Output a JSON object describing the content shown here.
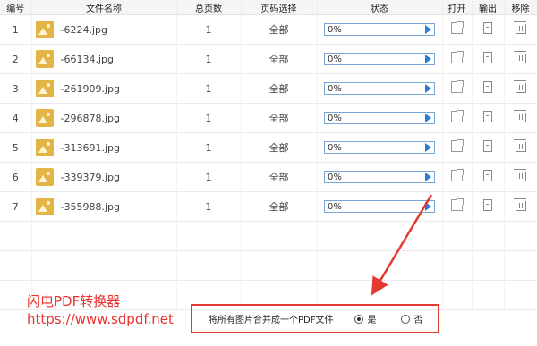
{
  "table": {
    "headers": {
      "index": "编号",
      "filename": "文件名称",
      "pages": "总页数",
      "page_select": "页码选择",
      "status": "状态",
      "open": "打开",
      "output": "输出",
      "remove": "移除"
    },
    "rows": [
      {
        "index": "1",
        "filename": "-6224.jpg",
        "pages": "1",
        "page_select": "全部",
        "status": "0%"
      },
      {
        "index": "2",
        "filename": "-66134.jpg",
        "pages": "1",
        "page_select": "全部",
        "status": "0%"
      },
      {
        "index": "3",
        "filename": "-261909.jpg",
        "pages": "1",
        "page_select": "全部",
        "status": "0%"
      },
      {
        "index": "4",
        "filename": "-296878.jpg",
        "pages": "1",
        "page_select": "全部",
        "status": "0%"
      },
      {
        "index": "5",
        "filename": "-313691.jpg",
        "pages": "1",
        "page_select": "全部",
        "status": "0%"
      },
      {
        "index": "6",
        "filename": "-339379.jpg",
        "pages": "1",
        "page_select": "全部",
        "status": "0%"
      },
      {
        "index": "7",
        "filename": "-355988.jpg",
        "pages": "1",
        "page_select": "全部",
        "status": "0%"
      }
    ],
    "icons": {
      "file": "image-file-icon",
      "play": "play-icon",
      "open": "open-external-icon",
      "output": "export-icon",
      "remove": "trash-icon"
    }
  },
  "watermark": {
    "line1": "闪电PDF转换器",
    "line2": "https://www.sdpdf.net",
    "color": "#e8332f"
  },
  "merge_option": {
    "label": "将所有图片合并成一个PDF文件",
    "yes": "是",
    "no": "否",
    "selected": "是",
    "highlight_color": "#e23a30"
  },
  "progress_color": "#2e7bd6"
}
